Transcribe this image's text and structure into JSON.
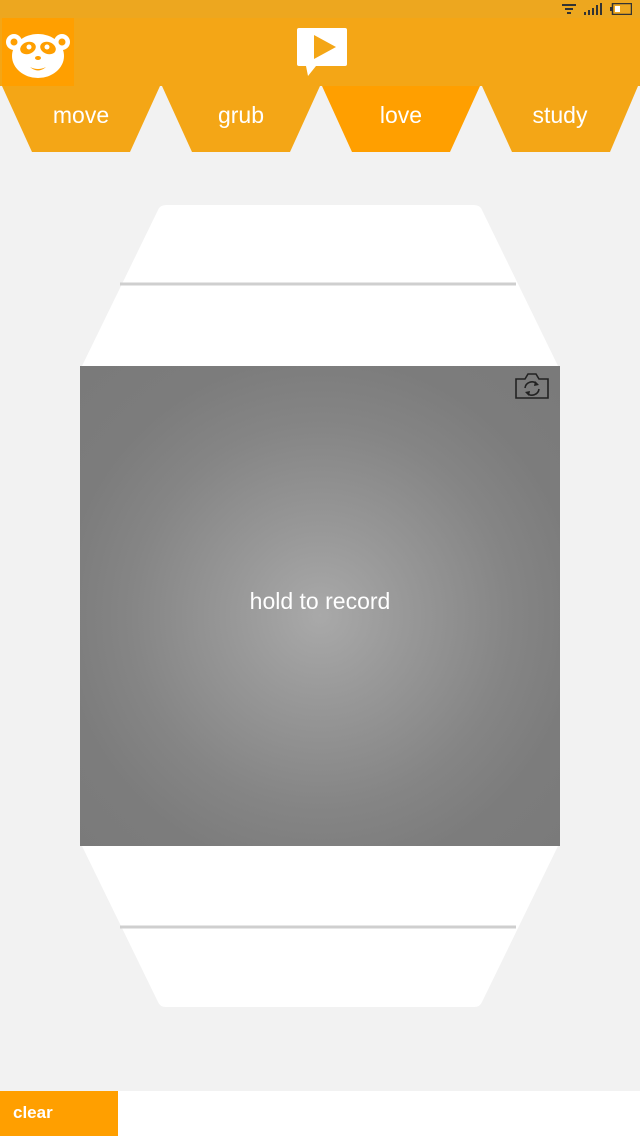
{
  "colors": {
    "status_bar": "#eda71f",
    "header": "#f4a616",
    "tab_inactive": "#f4a616",
    "tab_active": "#ff9f00",
    "clear_button": "#ff9f00",
    "background": "#f2f2f2"
  },
  "status_bar": {
    "icons": [
      "wifi-icon",
      "signal-icon",
      "battery-icon"
    ]
  },
  "header": {
    "logo_icon": "panda-logo-icon",
    "play_icon": "play-speech-bubble-icon"
  },
  "tabs": [
    {
      "label": "move",
      "active": false
    },
    {
      "label": "grub",
      "active": false
    },
    {
      "label": "love",
      "active": true
    },
    {
      "label": "study",
      "active": false
    }
  ],
  "recorder": {
    "prompt": "hold to record",
    "camera_switch_icon": "camera-switch-icon"
  },
  "bottom_bar": {
    "clear_label": "clear"
  }
}
